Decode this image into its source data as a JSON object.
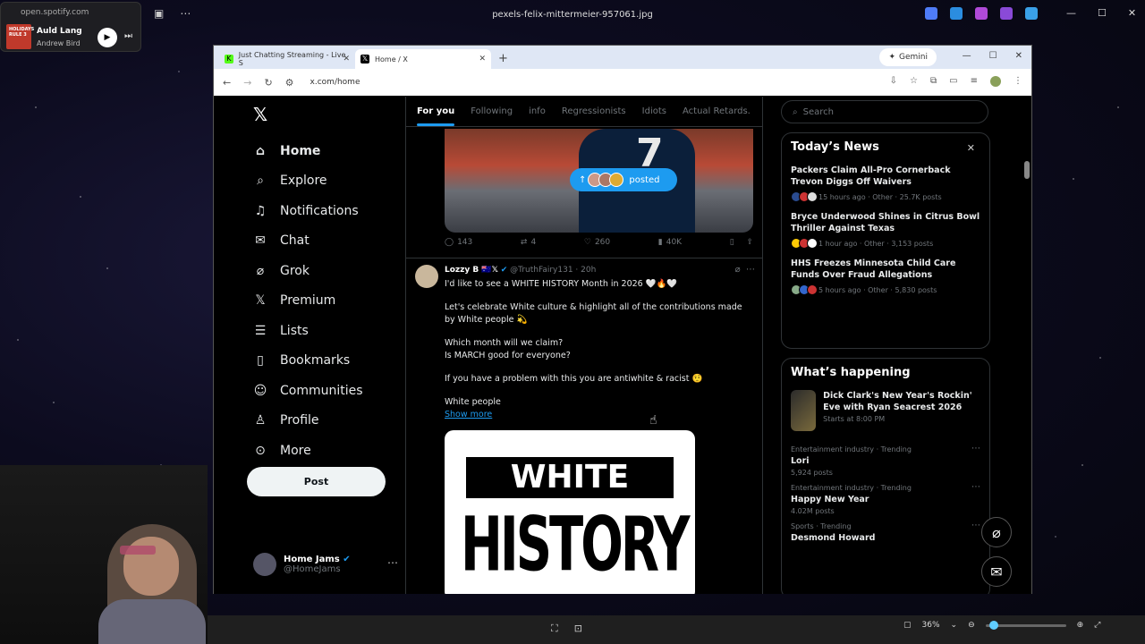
{
  "viewer": {
    "title": "pexels-felix-mittermeier-957061.jpg"
  },
  "spotify": {
    "url": "open.spotify.com",
    "song": "Auld Lang Syne",
    "artist": "Andrew Bird",
    "art_text": "HOLIDAYS RULE 3"
  },
  "browser": {
    "tabs": [
      {
        "label": "Just Chatting Streaming - Live S",
        "favicon": "kick-icon",
        "color": "#53fc18"
      },
      {
        "label": "Home / X",
        "favicon": "x-icon",
        "color": "#000000"
      }
    ],
    "gemini_label": "Gemini",
    "url": "x.com/home"
  },
  "nav": {
    "items": [
      {
        "label": "Home",
        "icon": "home-icon"
      },
      {
        "label": "Explore",
        "icon": "search-icon"
      },
      {
        "label": "Notifications",
        "icon": "bell-icon"
      },
      {
        "label": "Chat",
        "icon": "mail-icon"
      },
      {
        "label": "Grok",
        "icon": "grok-icon"
      },
      {
        "label": "Premium",
        "icon": "x-icon"
      },
      {
        "label": "Lists",
        "icon": "list-icon"
      },
      {
        "label": "Bookmarks",
        "icon": "bookmark-icon"
      },
      {
        "label": "Communities",
        "icon": "people-icon"
      },
      {
        "label": "Profile",
        "icon": "person-icon"
      },
      {
        "label": "More",
        "icon": "more-icon"
      }
    ],
    "post_label": "Post",
    "account": {
      "name": "Home Jams",
      "handle": "@HomeJams"
    }
  },
  "feed": {
    "tabs": [
      "For you",
      "Following",
      "info",
      "Regressionists",
      "Idiots",
      "Actual Retards."
    ],
    "posted_label": "posted",
    "jersey_number": "7",
    "prev_actions": {
      "replies": "143",
      "reposts": "4",
      "likes": "260",
      "views": "40K"
    },
    "tweet": {
      "name": "Lozzy B 🇦🇺𝕏",
      "handle": "@TruthFairy131",
      "time": "· 20h",
      "lines": [
        "I'd like to see a WHITE HISTORY Month in 2026 🤍🔥🤍",
        "Let's celebrate White culture & highlight all of the contributions made by White people 💫",
        "Which month will we claim?\nIs MARCH good for everyone?",
        "If you have a problem with this you are antiwhite & racist 🤨",
        "White people"
      ],
      "show_more": "Show more",
      "image_text_top": "WHITE",
      "image_text_bottom": "HISTORY"
    }
  },
  "sidebar": {
    "search_placeholder": "Search",
    "todays_news": {
      "title": "Today’s News",
      "items": [
        {
          "title": "Packers Claim All-Pro Cornerback Trevon Diggs Off Waivers",
          "meta": "15 hours ago · Other · 25.7K posts"
        },
        {
          "title": "Bryce Underwood Shines in Citrus Bowl Thriller Against Texas",
          "meta": "1 hour ago · Other · 3,153 posts"
        },
        {
          "title": "HHS Freezes Minnesota Child Care Funds Over Fraud Allegations",
          "meta": "5 hours ago · Other · 5,830 posts"
        }
      ]
    },
    "whats_happening": {
      "title": "What’s happening",
      "featured": {
        "title": "Dick Clark's New Year's Rockin' Eve with Ryan Seacrest 2026",
        "sub": "Starts at 8:00 PM"
      },
      "trends": [
        {
          "context": "Entertainment industry · Trending",
          "name": "Lori",
          "posts": "5,924 posts"
        },
        {
          "context": "Entertainment industry · Trending",
          "name": "Happy New Year",
          "posts": "4.02M posts"
        },
        {
          "context": "Sports · Trending",
          "name": "Desmond Howard",
          "posts": ""
        }
      ]
    }
  },
  "bottombar": {
    "zoom": "36%"
  }
}
